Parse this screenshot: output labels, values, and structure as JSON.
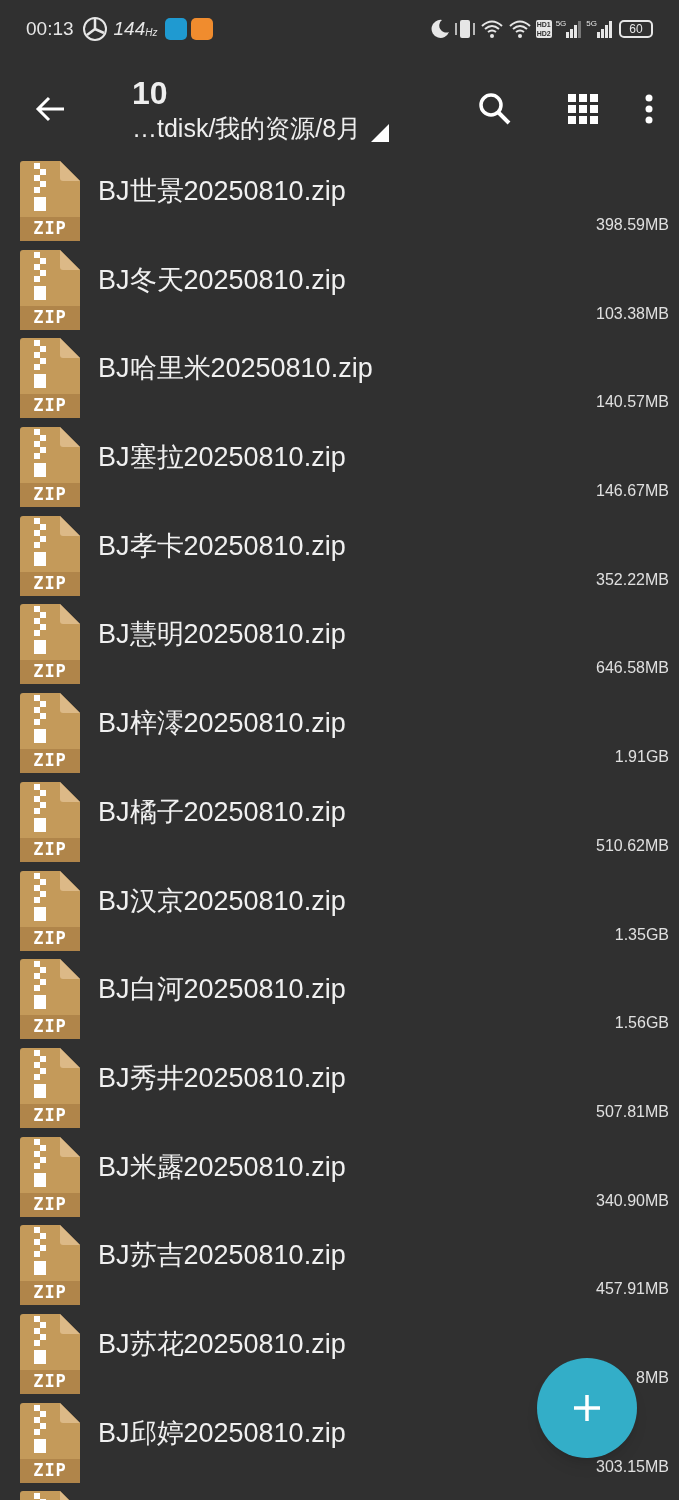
{
  "status_bar": {
    "time": "00:13",
    "refresh_rate": "144",
    "refresh_unit": "Hz",
    "battery": "60",
    "network_1": "5G",
    "network_2": "5G",
    "hd_top": "HD1",
    "hd_bottom": "HD2"
  },
  "toolbar": {
    "title": "10",
    "path": "…tdisk/我的资源/8月"
  },
  "files": [
    {
      "name": "BJ世景20250810.zip",
      "size": "398.59MB",
      "type": "ZIP"
    },
    {
      "name": "BJ冬天20250810.zip",
      "size": "103.38MB",
      "type": "ZIP"
    },
    {
      "name": "BJ哈里米20250810.zip",
      "size": "140.57MB",
      "type": "ZIP"
    },
    {
      "name": "BJ塞拉20250810.zip",
      "size": "146.67MB",
      "type": "ZIP"
    },
    {
      "name": "BJ孝卡20250810.zip",
      "size": "352.22MB",
      "type": "ZIP"
    },
    {
      "name": "BJ慧明20250810.zip",
      "size": "646.58MB",
      "type": "ZIP"
    },
    {
      "name": "BJ梓澪20250810.zip",
      "size": "1.91GB",
      "type": "ZIP"
    },
    {
      "name": "BJ橘子20250810.zip",
      "size": "510.62MB",
      "type": "ZIP"
    },
    {
      "name": "BJ汉京20250810.zip",
      "size": "1.35GB",
      "type": "ZIP"
    },
    {
      "name": "BJ白河20250810.zip",
      "size": "1.56GB",
      "type": "ZIP"
    },
    {
      "name": "BJ秀井20250810.zip",
      "size": "507.81MB",
      "type": "ZIP"
    },
    {
      "name": "BJ米露20250810.zip",
      "size": "340.90MB",
      "type": "ZIP"
    },
    {
      "name": "BJ苏吉20250810.zip",
      "size": "457.91MB",
      "type": "ZIP"
    },
    {
      "name": "BJ苏花20250810.zip",
      "size": "8MB",
      "type": "ZIP"
    },
    {
      "name": "BJ邱婷20250810.zip",
      "size": "303.15MB",
      "type": "ZIP"
    }
  ]
}
